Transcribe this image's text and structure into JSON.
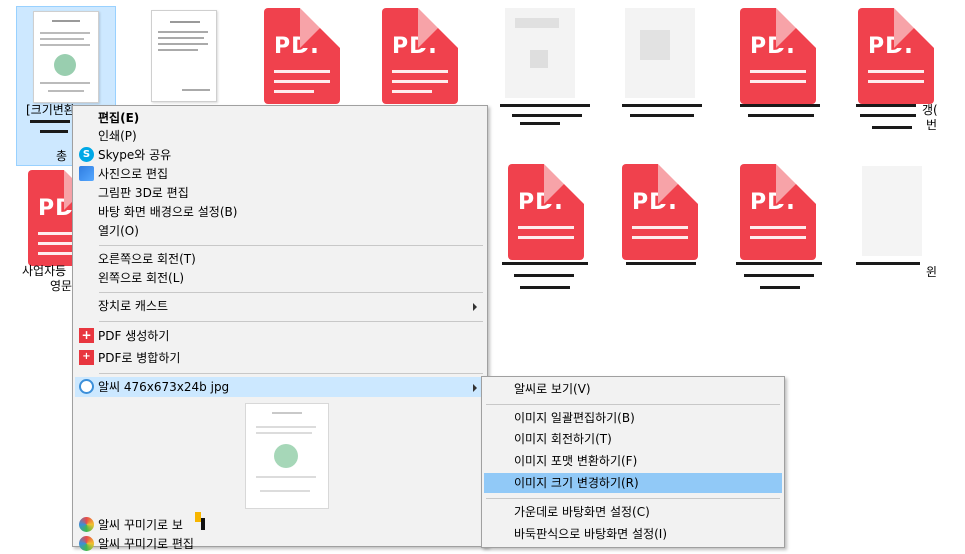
{
  "desktop": {
    "files": [
      {
        "label_line1": "[크기변환",
        "label_line3": "총"
      },
      {
        "label": ""
      },
      {
        "pdf_text": "PDF"
      },
      {
        "pdf_text": "PDF"
      },
      {
        "label": ""
      },
      {
        "label": ""
      },
      {
        "pdf_text": "PDI"
      },
      {
        "pdf_text": "PDF"
      },
      {
        "pdf_text": "PDF",
        "label_line1": "사업자등",
        "label_line2": "영문"
      },
      {
        "pdf_text": "PDF"
      },
      {
        "pdf_text": "PDF"
      },
      {
        "pdf_text": "PDI"
      }
    ],
    "side_labels": {
      "right1": "갱(",
      "right2": "번",
      "right3": "윈"
    }
  },
  "context_menu": {
    "items": [
      {
        "label": "편집(E)",
        "bold": true
      },
      {
        "label": "인쇄(P)"
      },
      {
        "label": "Skype와 공유",
        "icon": "skype-icon"
      },
      {
        "label": "사진으로 편집",
        "icon": "photos-icon"
      },
      {
        "label": "그림판 3D로 편집"
      },
      {
        "label": "바탕 화면 배경으로 설정(B)"
      },
      {
        "label": "열기(O)"
      },
      {
        "label": "오른쪽으로 회전(T)"
      },
      {
        "label": "왼쪽으로 회전(L)"
      },
      {
        "label": "장치로 캐스트"
      },
      {
        "label": "PDF 생성하기",
        "icon": "pdf-create-icon"
      },
      {
        "label": "PDF로 병합하기",
        "icon": "pdf-merge-icon"
      },
      {
        "label": "알씨 476x673x24b jpg",
        "icon": "alsee-icon"
      },
      {
        "label": "알씨 꾸미기로 보"
      },
      {
        "label": "알씨 꾸미기로 편집"
      }
    ]
  },
  "submenu": {
    "items": [
      {
        "label": "알씨로 보기(V)"
      },
      {
        "label": "이미지 일괄편집하기(B)"
      },
      {
        "label": "이미지 회전하기(T)"
      },
      {
        "label": "이미지 포맷 변환하기(F)"
      },
      {
        "label": "이미지 크기 변경하기(R)"
      },
      {
        "label": "가운데로 바탕화면 설정(C)"
      },
      {
        "label": "바둑판식으로 바탕화면 설정(I)"
      }
    ]
  },
  "colors": {
    "pdf_red": "#f0414d",
    "menu_bg": "#f2f2f2",
    "highlight": "#cce8ff",
    "highlight_strong": "#91c9f7",
    "selection": "#cde8ff"
  }
}
